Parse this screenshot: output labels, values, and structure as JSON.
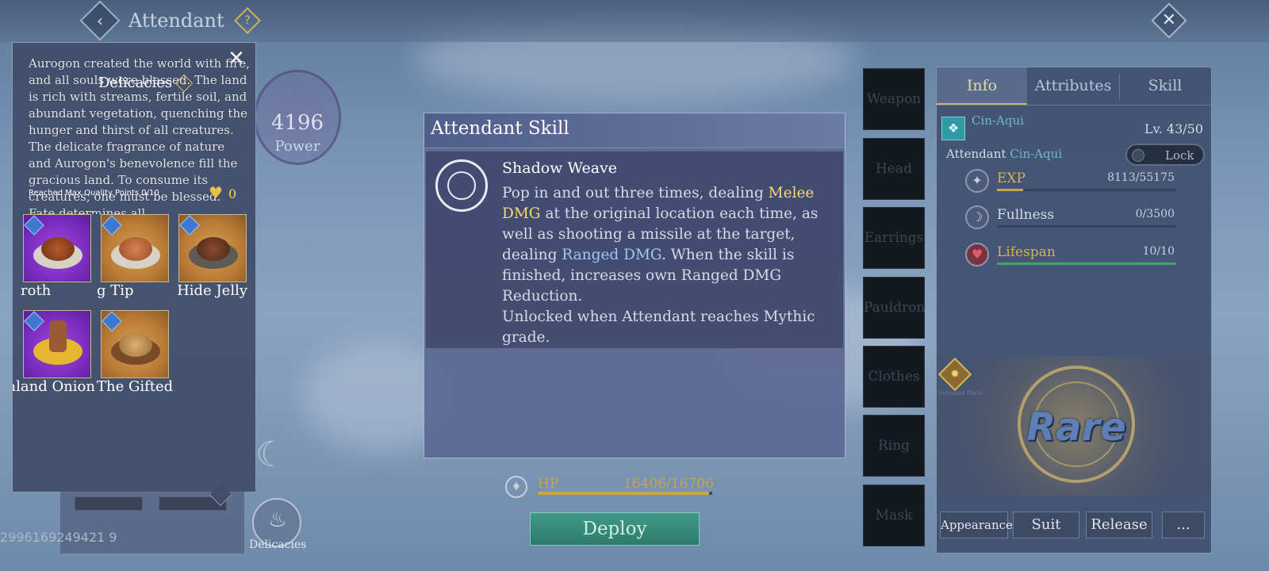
{
  "header": {
    "title": "Attendant",
    "back_icon": "‹",
    "help_icon": "?",
    "close_icon": "✕"
  },
  "power": {
    "value": "4196",
    "label": "Power"
  },
  "delicacies": {
    "title": "Delicacies",
    "help_icon": "?",
    "close_icon": "✕",
    "lore": "Aurogon created the world with fire, and all souls were blessed. The land is rich with streams, fertile soil, and abundant vegetation, quenching the hunger and thirst of all creatures. The delicate fragrance of nature and Aurogon's benevolence fill the gracious land. To consume its creatures, one must be blessed. Fate determines all.",
    "quality_label": "Reached Max Quality Points 0/10",
    "heart_count": "0",
    "items": [
      {
        "name": "roth",
        "bg": "purple"
      },
      {
        "name": "g Tip",
        "bg": "gold"
      },
      {
        "name": "rd Hide Jelly",
        "bg": "gold"
      },
      {
        "name": "eraland Onion",
        "bg": "purple"
      },
      {
        "name": "The Gifted",
        "bg": "gold"
      }
    ]
  },
  "bottom_left": {
    "id_text": "2996169249421 9",
    "delicacies_button": "Delicacies"
  },
  "skill_popup": {
    "title": "Attendant Skill",
    "skill_name": "Shadow Weave",
    "desc_1": "Pop in and out three times, dealing ",
    "melee": "Melee DMG",
    "desc_2": " at the original location each time, as well as shooting a missile at the target, dealing ",
    "ranged": "Ranged DMG",
    "desc_3": ". When the skill is finished, increases own Ranged DMG Reduction.",
    "desc_4": "Unlocked when Attendant reaches Mythic grade."
  },
  "hp": {
    "label": "HP",
    "value": "16406/16706",
    "fraction": 0.982
  },
  "deploy_label": "Deploy",
  "equipment": [
    "Weapon",
    "Head",
    "Earrings",
    "Pauldron",
    "Clothes",
    "Ring",
    "Mask"
  ],
  "info_panel": {
    "tabs": [
      "Info",
      "Attributes",
      "Skill"
    ],
    "active_tab": "Info",
    "species": "Cin-Aqui",
    "level": "Lv. 43/50",
    "attendant_label": "Attendant",
    "attendant_name": "Cin-Aqui",
    "lock_label": "Lock",
    "stats": [
      {
        "label": "EXP",
        "value": "8113/55175",
        "fraction": 0.147,
        "color": "#c8a54a",
        "icon": "exp-icon"
      },
      {
        "label": "Fullness",
        "value": "0/3500",
        "fraction": 0.0,
        "color": "#7aa0c8",
        "icon": "fullness-icon"
      },
      {
        "label": "Lifespan",
        "value": "10/10",
        "fraction": 1.0,
        "color": "#3fa56a",
        "icon": "heart-icon"
      }
    ],
    "increase_rank": "Increase Rank",
    "rank": "Rare",
    "buttons": [
      "Appearance",
      "Suit",
      "Release",
      "..."
    ]
  }
}
